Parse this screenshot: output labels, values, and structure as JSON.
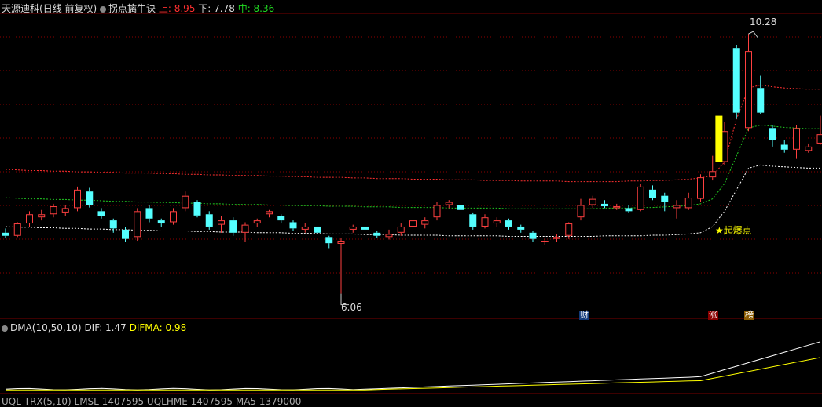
{
  "header": {
    "stock_name": "天源迪科",
    "period": "(日线 前复权)",
    "indicator": "拐点擒牛诀",
    "upper_label": "上: ",
    "upper_value": "8.95",
    "lower_label": "下: ",
    "lower_value": "7.78",
    "mid_label": "中: ",
    "mid_value": "8.36"
  },
  "price_annotations": {
    "high": "10.28",
    "low": "6.06",
    "signal": "★起爆点"
  },
  "event_tags": [
    "财",
    "涨",
    "榜"
  ],
  "sub_header": {
    "name": "DMA(10,50,10)",
    "dif_label": "DIF: ",
    "dif_value": "1.47",
    "difma_label": "DIFMA: ",
    "difma_value": "0.98"
  },
  "bottom_header_partial": "UQL TRX(5,10) LMSL 1407595 UQLHME 1407595 MA5 1379000",
  "colors": {
    "background": "#000000",
    "up_candle": "#ff4040",
    "down_candle": "#54ffff",
    "signal_bar": "#ffff00",
    "upper_band": "#ff3030",
    "mid_band": "#22cc22",
    "lower_band": "#ffffff",
    "grid": "#8b0000",
    "dif_line": "#ffffff",
    "difma_line": "#ffff00"
  },
  "chart_data": {
    "type": "candlestick",
    "ylim": [
      5.8,
      10.6
    ],
    "candles": [
      [
        7.05,
        7.0,
        7.12,
        6.96
      ],
      [
        7.0,
        7.2,
        7.22,
        6.98
      ],
      [
        7.2,
        7.35,
        7.4,
        7.15
      ],
      [
        7.3,
        7.35,
        7.42,
        7.25
      ],
      [
        7.35,
        7.48,
        7.52,
        7.3
      ],
      [
        7.38,
        7.45,
        7.5,
        7.32
      ],
      [
        7.45,
        7.75,
        7.8,
        7.4
      ],
      [
        7.72,
        7.5,
        7.78,
        7.46
      ],
      [
        7.4,
        7.32,
        7.45,
        7.28
      ],
      [
        7.25,
        7.12,
        7.28,
        7.05
      ],
      [
        7.1,
        6.95,
        7.15,
        6.9
      ],
      [
        6.98,
        7.4,
        7.45,
        6.92
      ],
      [
        7.45,
        7.28,
        7.5,
        7.22
      ],
      [
        7.25,
        7.2,
        7.28,
        7.15
      ],
      [
        7.22,
        7.4,
        7.45,
        7.18
      ],
      [
        7.45,
        7.65,
        7.72,
        7.4
      ],
      [
        7.55,
        7.33,
        7.58,
        7.3
      ],
      [
        7.35,
        7.15,
        7.4,
        7.1
      ],
      [
        7.18,
        7.25,
        7.32,
        7.05
      ],
      [
        7.25,
        7.05,
        7.3,
        7.0
      ],
      [
        7.05,
        7.18,
        7.22,
        6.9
      ],
      [
        7.2,
        7.25,
        7.28,
        7.15
      ],
      [
        7.35,
        7.4,
        7.42,
        7.3
      ],
      [
        7.32,
        7.25,
        7.35,
        7.2
      ],
      [
        7.22,
        7.12,
        7.25,
        7.08
      ],
      [
        7.1,
        7.15,
        7.2,
        7.05
      ],
      [
        7.15,
        7.05,
        7.18,
        7.0
      ],
      [
        6.98,
        6.88,
        7.0,
        6.8
      ],
      [
        6.87,
        6.92,
        6.96,
        6.06
      ],
      [
        7.1,
        7.15,
        7.18,
        7.05
      ],
      [
        7.15,
        7.1,
        7.18,
        7.06
      ],
      [
        7.05,
        7.0,
        7.08,
        6.96
      ],
      [
        6.98,
        7.03,
        7.1,
        6.94
      ],
      [
        7.05,
        7.15,
        7.2,
        7.0
      ],
      [
        7.15,
        7.25,
        7.3,
        7.1
      ],
      [
        7.18,
        7.25,
        7.3,
        7.12
      ],
      [
        7.3,
        7.5,
        7.55,
        7.25
      ],
      [
        7.5,
        7.55,
        7.58,
        7.45
      ],
      [
        7.5,
        7.42,
        7.55,
        7.38
      ],
      [
        7.35,
        7.15,
        7.38,
        7.1
      ],
      [
        7.15,
        7.3,
        7.35,
        7.12
      ],
      [
        7.2,
        7.25,
        7.3,
        7.15
      ],
      [
        7.25,
        7.15,
        7.28,
        7.1
      ],
      [
        7.15,
        7.1,
        7.18,
        7.05
      ],
      [
        7.05,
        6.95,
        7.08,
        6.9
      ],
      [
        6.9,
        6.92,
        6.95,
        6.85
      ],
      [
        6.95,
        6.98,
        7.02,
        6.9
      ],
      [
        7.0,
        7.2,
        7.22,
        6.95
      ],
      [
        7.3,
        7.5,
        7.6,
        7.25
      ],
      [
        7.5,
        7.6,
        7.65,
        7.45
      ],
      [
        7.52,
        7.48,
        7.58,
        7.45
      ],
      [
        7.45,
        7.48,
        7.52,
        7.42
      ],
      [
        7.45,
        7.4,
        7.5,
        7.38
      ],
      [
        7.42,
        7.8,
        7.85,
        7.4
      ],
      [
        7.75,
        7.62,
        7.82,
        7.58
      ],
      [
        7.65,
        7.55,
        7.7,
        7.4
      ],
      [
        7.45,
        7.5,
        7.58,
        7.28
      ],
      [
        7.45,
        7.62,
        7.7,
        7.42
      ],
      [
        7.6,
        7.95,
        8.0,
        7.55
      ],
      [
        7.95,
        8.05,
        8.3,
        7.9
      ],
      [
        8.2,
        8.7,
        8.85,
        8.15
      ],
      [
        10.05,
        9.0,
        10.1,
        8.9
      ],
      [
        8.75,
        10.0,
        10.28,
        8.7
      ],
      [
        9.4,
        9.0,
        9.6,
        8.98
      ],
      [
        8.75,
        8.55,
        8.8,
        8.45
      ],
      [
        8.48,
        8.4,
        8.55,
        8.35
      ],
      [
        8.4,
        8.75,
        8.8,
        8.25
      ],
      [
        8.38,
        8.45,
        8.5,
        8.35
      ],
      [
        8.5,
        8.65,
        8.95,
        8.48
      ]
    ],
    "signal_bar": [
      8.2,
      8.95
    ],
    "upper_band": [
      8.08,
      8.07,
      8.06,
      8.06,
      8.05,
      8.05,
      8.04,
      8.04,
      8.03,
      8.03,
      8.02,
      8.02,
      8.02,
      8.01,
      8.01,
      8.0,
      8.0,
      7.99,
      7.99,
      7.98,
      7.98,
      7.98,
      7.97,
      7.97,
      7.96,
      7.96,
      7.95,
      7.95,
      7.95,
      7.94,
      7.94,
      7.93,
      7.93,
      7.93,
      7.92,
      7.92,
      7.92,
      7.91,
      7.91,
      7.91,
      7.9,
      7.9,
      7.9,
      7.89,
      7.89,
      7.89,
      7.89,
      7.88,
      7.88,
      7.88,
      7.88,
      7.88,
      7.89,
      7.89,
      7.9,
      7.9,
      7.91,
      7.92,
      7.94,
      7.98,
      8.2,
      8.9,
      9.4,
      9.45,
      9.42,
      9.4,
      9.39,
      9.38,
      9.38
    ],
    "mid_band": [
      7.62,
      7.61,
      7.6,
      7.6,
      7.59,
      7.59,
      7.58,
      7.58,
      7.57,
      7.56,
      7.56,
      7.55,
      7.55,
      7.54,
      7.54,
      7.53,
      7.53,
      7.52,
      7.52,
      7.51,
      7.51,
      7.51,
      7.5,
      7.5,
      7.49,
      7.49,
      7.49,
      7.48,
      7.48,
      7.48,
      7.47,
      7.47,
      7.47,
      7.46,
      7.46,
      7.46,
      7.46,
      7.45,
      7.45,
      7.45,
      7.45,
      7.45,
      7.44,
      7.44,
      7.44,
      7.44,
      7.44,
      7.44,
      7.44,
      7.44,
      7.45,
      7.45,
      7.45,
      7.46,
      7.46,
      7.47,
      7.48,
      7.49,
      7.52,
      7.6,
      7.85,
      8.3,
      8.75,
      8.8,
      8.78,
      8.76,
      8.75,
      8.74,
      8.74
    ],
    "lower_band": [
      7.15,
      7.14,
      7.14,
      7.13,
      7.13,
      7.12,
      7.12,
      7.11,
      7.11,
      7.1,
      7.1,
      7.09,
      7.09,
      7.08,
      7.08,
      7.08,
      7.07,
      7.07,
      7.06,
      7.06,
      7.06,
      7.05,
      7.05,
      7.05,
      7.04,
      7.04,
      7.04,
      7.03,
      7.03,
      7.03,
      7.02,
      7.02,
      7.02,
      7.01,
      7.01,
      7.01,
      7.01,
      7.0,
      7.0,
      7.0,
      7.0,
      7.0,
      6.99,
      6.99,
      6.99,
      6.99,
      6.99,
      6.99,
      6.99,
      6.99,
      7.0,
      7.0,
      7.0,
      7.0,
      7.01,
      7.01,
      7.02,
      7.03,
      7.05,
      7.15,
      7.4,
      7.75,
      8.1,
      8.15,
      8.13,
      8.12,
      8.11,
      8.1,
      8.1
    ],
    "dmas": {
      "ylim": [
        0,
        1.6
      ]
    }
  }
}
